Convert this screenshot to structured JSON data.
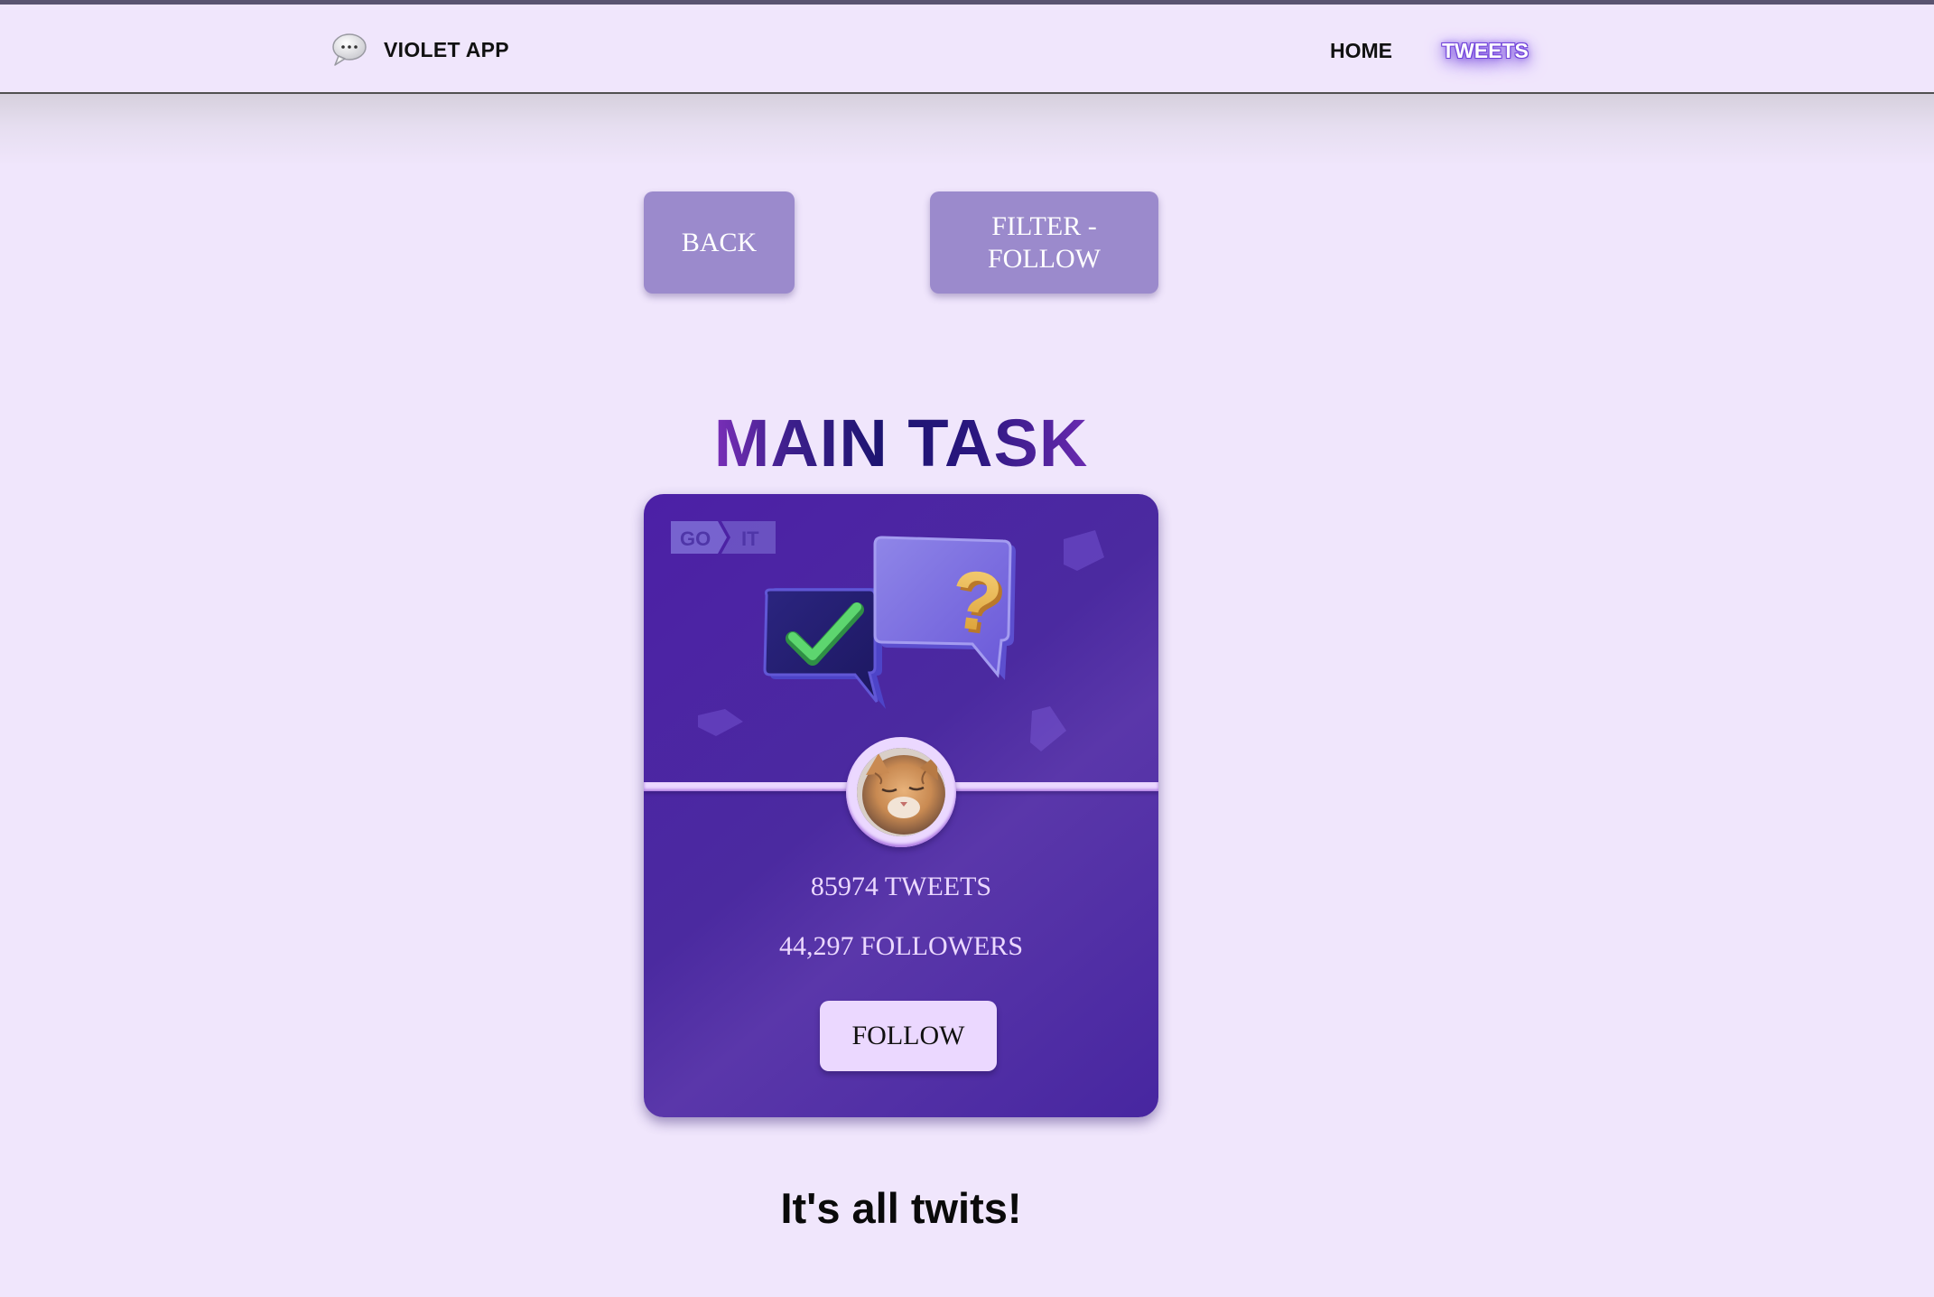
{
  "header": {
    "app_name": "VIOLET APP",
    "logo_icon": "chat-bubble-icon",
    "nav": [
      {
        "label": "HOME",
        "active": false
      },
      {
        "label": "TWEETS",
        "active": true
      }
    ]
  },
  "toolbar": {
    "back_label": "BACK",
    "filter_label": "FILTER - FOLLOW"
  },
  "main": {
    "title": "MAIN TASK"
  },
  "card": {
    "logo_left": "GO",
    "logo_right": "IT",
    "tweets": "85974 TWEETS",
    "followers": "44,297 FOLLOWERS",
    "follow_button": "FOLLOW"
  },
  "footer": {
    "text": "It's all twits!"
  },
  "colors": {
    "background": "#f0e6fc",
    "button": "#9b8acc",
    "card": "#4c20a6",
    "card_accent": "#ebd8ff"
  }
}
